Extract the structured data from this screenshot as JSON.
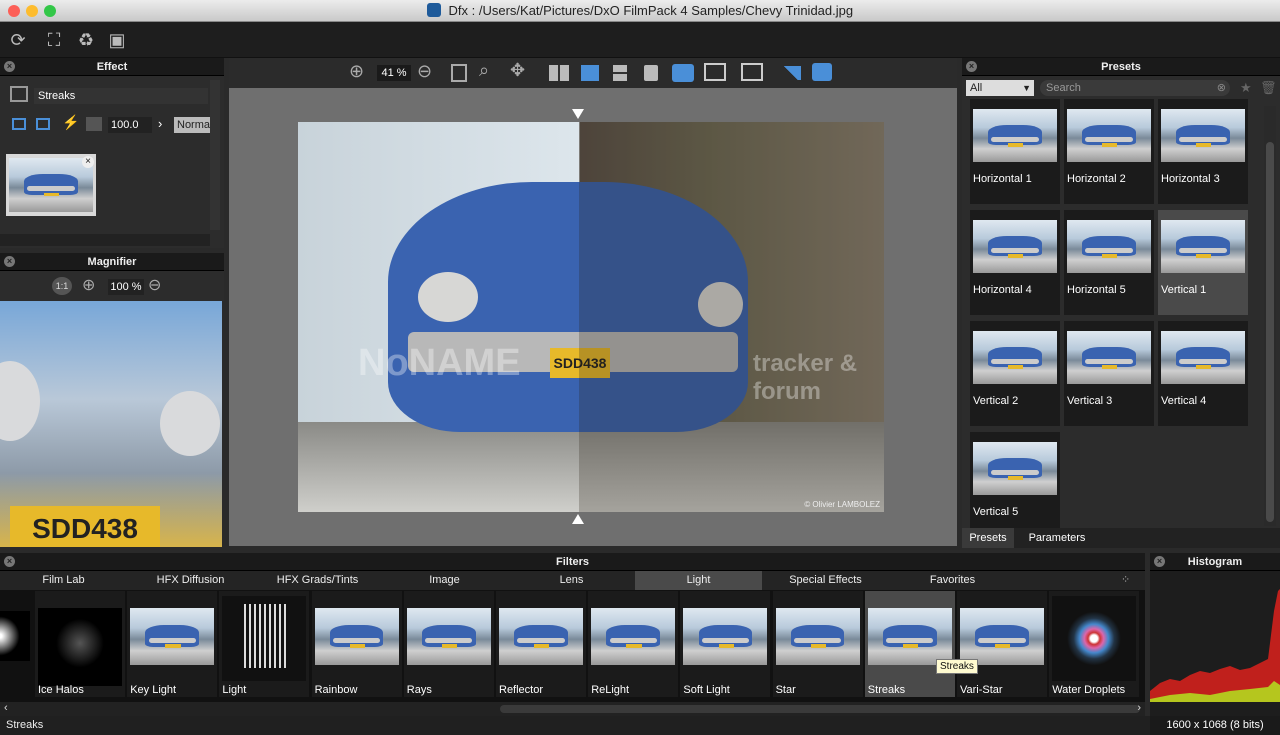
{
  "window": {
    "title": "Dfx : /Users/Kat/Pictures/DxO FilmPack 4 Samples/Chevy Trinidad.jpg"
  },
  "colors": {
    "accent": "#3a63b0",
    "selected": "#4a4a4a",
    "red_channel": "#c0201c",
    "yellow_channel": "#b5c61e"
  },
  "toolbar": {
    "icons": [
      "refresh-icon",
      "crop-icon",
      "recycle-icon",
      "fit-icon"
    ]
  },
  "effect_panel": {
    "title": "Effect",
    "effect_name": "Streaks",
    "opacity": "100.0",
    "blend_mode": "Normal"
  },
  "magnifier_panel": {
    "title": "Magnifier",
    "zoom": "100 %"
  },
  "canvas_toolbar": {
    "zoom": "41 %"
  },
  "watermark": {
    "left": "NoNAME",
    "right": "tracker & forum",
    "credit": "© Olivier LAMBOLEZ"
  },
  "presets_panel": {
    "title": "Presets",
    "filter_value": "All",
    "search_placeholder": "Search",
    "items": [
      "Horizontal 1",
      "Horizontal 2",
      "Horizontal 3",
      "Horizontal 4",
      "Horizontal 5",
      "Vertical 1",
      "Vertical 2",
      "Vertical 3",
      "Vertical 4",
      "Vertical 5"
    ],
    "selected": "Vertical 1",
    "tabs": [
      "Presets",
      "Parameters"
    ]
  },
  "filters_panel": {
    "title": "Filters",
    "tabs": [
      "Film Lab",
      "HFX Diffusion",
      "HFX Grads/Tints",
      "Image",
      "Lens",
      "Light",
      "Special Effects",
      "Favorites"
    ],
    "active_tab": "Light",
    "items": [
      "Ice Halos",
      "Key Light",
      "Light",
      "Rainbow",
      "Rays",
      "Reflector",
      "ReLight",
      "Soft Light",
      "Star",
      "Streaks",
      "Vari-Star",
      "Water Droplets"
    ],
    "selected": "Streaks",
    "tooltip": "Streaks"
  },
  "histogram_panel": {
    "title": "Histogram",
    "image_info": "1600 x 1068 (8 bits)"
  },
  "status_bar": {
    "text": "Streaks"
  }
}
